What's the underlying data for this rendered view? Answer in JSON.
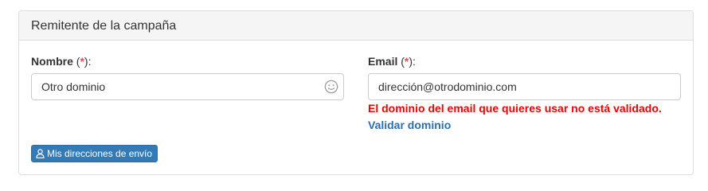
{
  "panel": {
    "title": "Remitente de la campaña"
  },
  "nombre": {
    "label": "Nombre",
    "required_open": "(",
    "required_mark": "*",
    "required_close": "):",
    "value": "Otro dominio",
    "icon": "emoji-smile-icon"
  },
  "email": {
    "label": "Email",
    "required_open": "(",
    "required_mark": "*",
    "required_close": "):",
    "value": "dirección@otrodominio.com",
    "error": "El dominio del email que quieres usar no está validado.",
    "validate_link": "Validar dominio"
  },
  "addresses_button": {
    "label": "Mis direcciones de envío",
    "icon": "user-icon"
  },
  "colors": {
    "primary": "#337ab7",
    "error": "#ee0000",
    "link": "#2a6db0",
    "required": "#d9534f"
  }
}
